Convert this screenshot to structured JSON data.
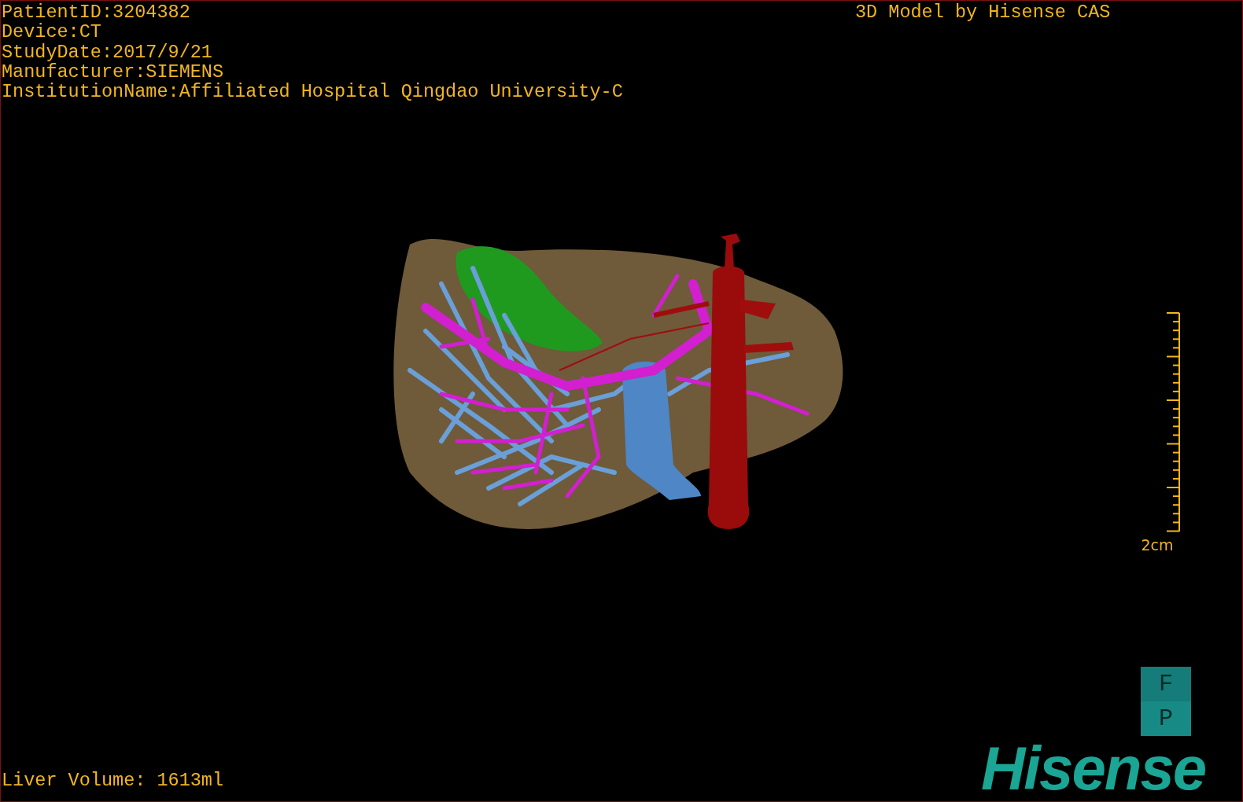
{
  "study_info": [
    "PatientID:3204382",
    "Device:CT",
    "StudyDate:2017/9/21",
    "Manufacturer:SIEMENS",
    "InstitutionName:Affiliated Hospital Qingdao University-C"
  ],
  "model_credit": "3D Model by Hisense CAS",
  "scale_bar": {
    "label": "2cm"
  },
  "orientation_cube": [
    "F",
    "P"
  ],
  "logo": "Hisense",
  "liver_volume": "Liver Volume: 1613ml"
}
